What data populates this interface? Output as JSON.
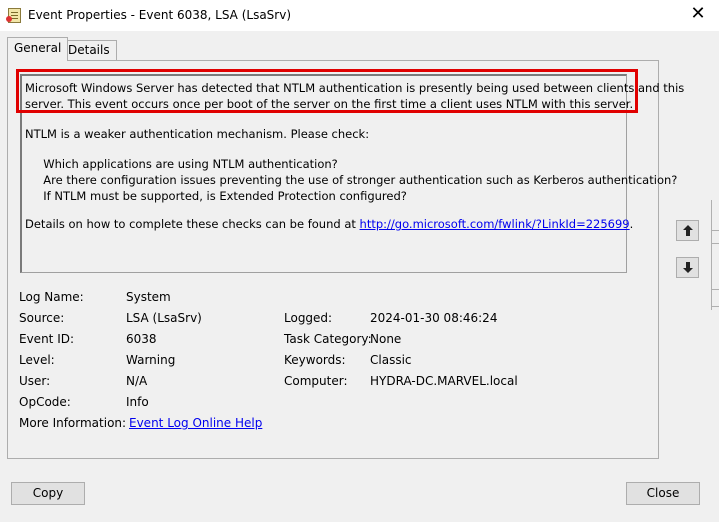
{
  "window": {
    "title": "Event Properties - Event 6038, LSA (LsaSrv)",
    "close_glyph": "✕",
    "icon": "event-viewer-icon"
  },
  "tabs": [
    {
      "label": "General",
      "active": true
    },
    {
      "label": "Details",
      "active": false
    }
  ],
  "description": {
    "lines": [
      "Microsoft Windows Server has detected that NTLM authentication is presently being used between clients and this",
      "server. This event occurs once per boot of the server on the first time a client uses NTLM with this server.",
      "",
      "NTLM is a weaker authentication mechanism. Please check:",
      "",
      "     Which applications are using NTLM authentication?",
      "     Are there configuration issues preventing the use of stronger authentication such as Kerberos authentication?",
      "     If NTLM must be supported, is Extended Protection configured?",
      "",
      "Details on how to complete these checks can be found at "
    ],
    "link_text": "http://go.microsoft.com/fwlink/?LinkId=225699",
    "link_suffix": "."
  },
  "fields": {
    "log_name": {
      "label": "Log Name:",
      "value": "System"
    },
    "source": {
      "label": "Source:",
      "value": "LSA (LsaSrv)"
    },
    "logged": {
      "label": "Logged:",
      "value": "2024-01-30 08:46:24"
    },
    "event_id": {
      "label": "Event ID:",
      "value": "6038"
    },
    "task_category": {
      "label": "Task Category:",
      "value": "None"
    },
    "level": {
      "label": "Level:",
      "value": "Warning"
    },
    "keywords": {
      "label": "Keywords:",
      "value": "Classic"
    },
    "user": {
      "label": "User:",
      "value": "N/A"
    },
    "computer": {
      "label": "Computer:",
      "value": "HYDRA-DC.MARVEL.local"
    },
    "opcode": {
      "label": "OpCode:",
      "value": "Info"
    },
    "more_info": {
      "label": "More Information:",
      "link": "Event Log Online Help"
    }
  },
  "buttons": {
    "copy": "Copy",
    "close": "Close"
  },
  "colors": {
    "highlight": "#e00000",
    "link": "#0000ee"
  }
}
